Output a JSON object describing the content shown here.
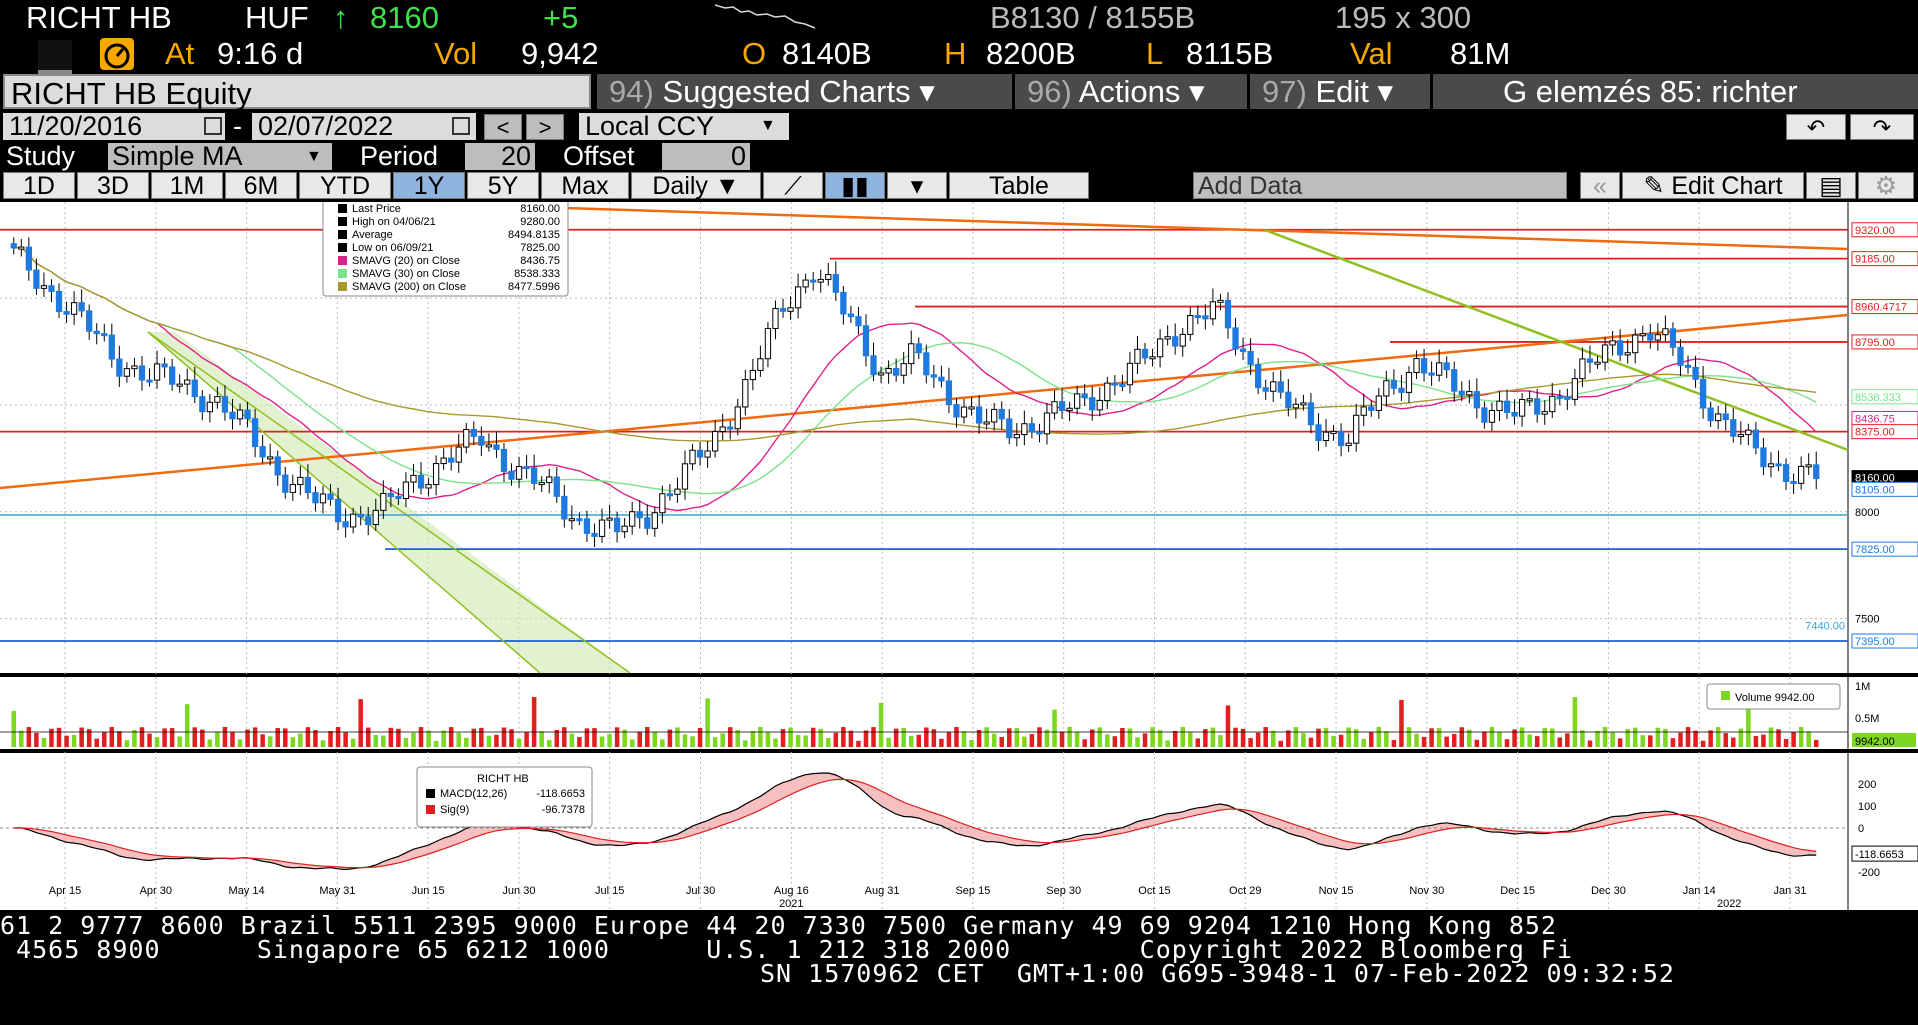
{
  "quote": {
    "ticker": "RICHT HB",
    "currency": "HUF",
    "arrow": "↑",
    "last": "8160",
    "change": "+5",
    "bid_ask": "B8130 / 8155B",
    "size": "195 x 300",
    "at_label": "At",
    "time": "9:16 d",
    "vol_label": "Vol",
    "vol": "9,942",
    "open_label": "O",
    "open": "8140B",
    "high_label": "H",
    "high": "8200B",
    "low_label": "L",
    "low": "8115B",
    "val_label": "Val",
    "val": "81M"
  },
  "titlebar": {
    "security": "RICHT HB Equity",
    "menu": [
      {
        "num": "94)",
        "label": "Suggested Charts ▾"
      },
      {
        "num": "96)",
        "label": "Actions ▾"
      },
      {
        "num": "97)",
        "label": "Edit ▾"
      }
    ],
    "chart_name": "G elemzés 85: richter"
  },
  "dates": {
    "start": "11/20/2016",
    "sep": "-",
    "end": "02/07/2022",
    "prev": "<",
    "next": ">",
    "currency_mode": "Local CCY"
  },
  "study": {
    "label": "Study",
    "value": "Simple MA",
    "period_label": "Period",
    "period": "20",
    "offset_label": "Offset",
    "offset": "0"
  },
  "toolbar": {
    "ranges": [
      "1D",
      "3D",
      "1M",
      "6M",
      "YTD",
      "1Y",
      "5Y",
      "Max"
    ],
    "selected": "1Y",
    "frequency": "Daily ▼",
    "table": "Table",
    "add_data": "Add Data",
    "edit_chart": "Edit Chart"
  },
  "legend": {
    "rows": [
      {
        "label": "Last Price",
        "value": "8160.00",
        "color": "#000000"
      },
      {
        "label": "High on 04/06/21",
        "value": "9280.00",
        "color": "#000000"
      },
      {
        "label": "Average",
        "value": "8494.8135",
        "color": "#000000"
      },
      {
        "label": "Low on 06/09/21",
        "value": "7825.00",
        "color": "#000000"
      },
      {
        "label": "SMAVG (20)  on Close",
        "value": "8436.75",
        "color": "#e0208a"
      },
      {
        "label": "SMAVG (30)  on Close",
        "value": "8538.333",
        "color": "#7be38a"
      },
      {
        "label": "SMAVG (200)  on Close",
        "value": "8477.5996",
        "color": "#a69a2e"
      }
    ]
  },
  "price_axis": {
    "ticks": [
      "9320.00",
      "9185.00",
      "8960.4717",
      "8795.00",
      "8538.333",
      "8436.75",
      "8375.00",
      "8160.00",
      "8105.00",
      "8000",
      "7825.00",
      "7500",
      "7440.00",
      "7395.00"
    ]
  },
  "volume_panel": {
    "legend": "Volume 9942.00",
    "ticks": [
      "1M",
      "0.5M",
      "9942.00"
    ],
    "legend_color": "#7dd61f"
  },
  "macd_panel": {
    "legend_title": "RICHT HB",
    "rows": [
      {
        "label": "MACD(12,26)",
        "value": "-118.6653",
        "color": "#000000"
      },
      {
        "label": "Sig(9)",
        "value": "-96.7378",
        "color": "#e02020"
      }
    ],
    "ticks": [
      "200",
      "100",
      "0",
      "-100",
      "-200"
    ],
    "current": "-118.6653"
  },
  "x_axis": {
    "labels": [
      "Apr 15",
      "Apr 30",
      "May 14",
      "May 31",
      "Jun 15",
      "Jun 30",
      "Jul 15",
      "Jul 30",
      "Aug 16",
      "Aug 31",
      "Sep 15",
      "Sep 30",
      "Oct 15",
      "Oct 29",
      "Nov 15",
      "Nov 30",
      "Dec 15",
      "Dec 30",
      "Jan 14",
      "Jan 31"
    ],
    "years": [
      "2021",
      "2022"
    ]
  },
  "footer": {
    "line1": "61 2 9777 8600 Brazil 5511 2395 9000 Europe 44 20 7330 7500 Germany 49 69 9204 1210 Hong Kong 852",
    "line2": " 4565 8900      Singapore 65 6212 1000      U.S. 1 212 318 2000        Copyright 2022 Bloomberg Fi",
    "line3": "SN 1570962 CET  GMT+1:00 G695-3948-1 07-Feb-2022 09:32:52"
  },
  "chart_data": {
    "type": "candlestick",
    "title": "",
    "ylim": [
      7250,
      9450
    ],
    "horizontal_levels": [
      {
        "value": 9320,
        "label": "9320.00",
        "color": "#e02020"
      },
      {
        "value": 9185,
        "label": "9185.00",
        "color": "#e02020"
      },
      {
        "value": 8960.4717,
        "label": "8960.4717",
        "color": "#e02020"
      },
      {
        "value": 8795,
        "label": "8795.00",
        "color": "#e02020"
      },
      {
        "value": 8375,
        "label": "8375.00",
        "color": "#e02020"
      },
      {
        "value": 7825,
        "label": "7825.00",
        "color": "#2060d0"
      },
      {
        "value": 7395,
        "label": "7395.00",
        "color": "#2060d0"
      }
    ],
    "close_series_sample": [
      9200,
      9050,
      8900,
      8720,
      8640,
      8600,
      8520,
      8380,
      8180,
      8050,
      7980,
      8000,
      8150,
      8250,
      8350,
      8200,
      8100,
      7950,
      7900,
      8000,
      8150,
      8350,
      8600,
      8950,
      9150,
      8900,
      8650,
      8720,
      8550,
      8420,
      8380,
      8450,
      8500,
      8620,
      8720,
      8880,
      8950,
      8700,
      8520,
      8400,
      8350,
      8550,
      8700,
      8600,
      8500,
      8450,
      8520,
      8650,
      8780,
      8850,
      8700,
      8450,
      8300,
      8200,
      8160
    ]
  }
}
